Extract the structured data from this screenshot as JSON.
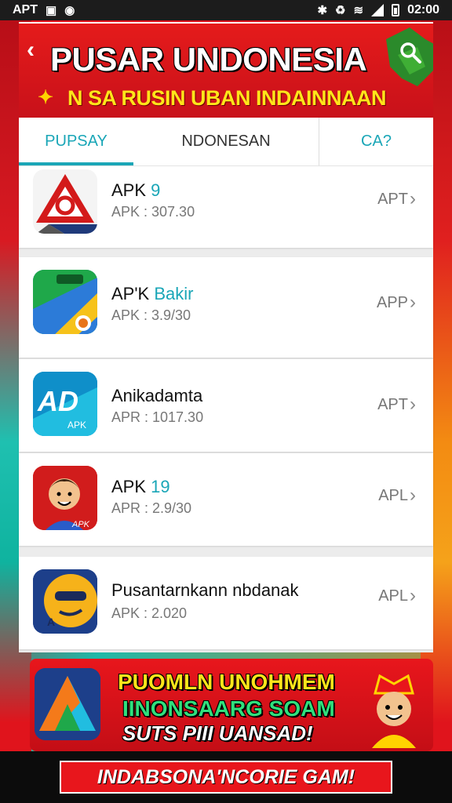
{
  "status_bar": {
    "left_text": "APT",
    "time": "02:00"
  },
  "header": {
    "title": "PUSAR UNDONESIA",
    "subtitle": "N SA RUSIN UBAN INDAINNAAN"
  },
  "tabs": [
    {
      "label": "PUPSAY"
    },
    {
      "label": "NDONESAN"
    },
    {
      "label": "CA?"
    }
  ],
  "list": {
    "items": [
      {
        "name": "APK",
        "name_accent": " 9",
        "sub": "APK : 307.30",
        "action": "APT"
      },
      {
        "name": "AP'K",
        "name_accent": " Bakir",
        "sub": "APK : 3.9/30",
        "action": "APP"
      },
      {
        "name": "Anikadamta",
        "name_accent": "",
        "sub": "APR : 1017.30",
        "action": "APT"
      },
      {
        "name": "APK",
        "name_accent": " 19",
        "sub": "APR : 2.9/30",
        "action": "APL"
      },
      {
        "name": "Pusantarnkann nbdanak",
        "name_accent": "",
        "sub": "APK : 2.020",
        "action": "APL"
      }
    ]
  },
  "promo": {
    "line1": "PUOMLN UNOHMEM",
    "line2": "IINONSAARG SOAM",
    "line3": "SUTS PIII UANSAD!"
  },
  "bottom_bar": {
    "label": "INDABSONA'NCORIE GAM!"
  },
  "colors": {
    "brand_red": "#e51b1b",
    "accent_teal": "#1aa6b7",
    "promo_yellow": "#ffe51a",
    "promo_green": "#2fe07c"
  }
}
